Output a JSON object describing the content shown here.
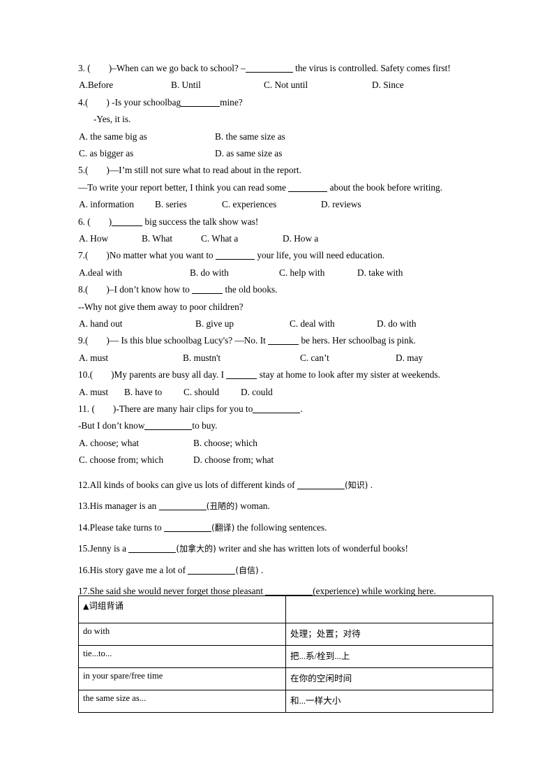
{
  "document": {
    "type": "english-grammar-worksheet",
    "questions": [
      {
        "id": "q3",
        "number": "3. (",
        "close": ")",
        "stem_before": "–When can we go back to school? –",
        "stem_after": " the virus is controlled. Safety comes first!",
        "options": [
          "A.Before",
          "B. Until",
          "C. Not until",
          "D. Since"
        ]
      },
      {
        "id": "q4",
        "number": "4.(",
        "close": ")",
        "stem_before": " -Is your schoolbag",
        "stem_after": "mine?",
        "second_line": "-Yes, it is.",
        "options": [
          "A. the same big as",
          "B. the same size as",
          "C. as bigger as",
          "D. as same size as"
        ]
      },
      {
        "id": "q5",
        "number": "5.(",
        "close": ")",
        "stem_before": "—I’m still not sure what to read about in the report.",
        "second_line_before": "—To write your report better, I think you can read some ",
        "second_line_after": " about the book before writing.",
        "options": [
          "A. information",
          "B. series",
          "C. experiences",
          "D. reviews"
        ]
      },
      {
        "id": "q6",
        "number": "6. (",
        "close": ")",
        "stem_after": " big success the talk show was!",
        "options": [
          "A. How",
          "B. What",
          "C. What a",
          "D. How a"
        ]
      },
      {
        "id": "q7",
        "number": "7.(",
        "close": ")",
        "stem_before": "No matter what you want to ",
        "stem_after": " your life, you will need education.",
        "options": [
          "A.deal with",
          "B. do with",
          "C. help with",
          "D. take with"
        ]
      },
      {
        "id": "q8",
        "number": "8.(",
        "close": ")",
        "stem_before": "–I don’t know how to ",
        "stem_after": " the old books.",
        "second_line": "--Why not give them away to poor children?",
        "options": [
          "A. hand out",
          "B. give up",
          "C. deal with",
          "D. do with"
        ]
      },
      {
        "id": "q9",
        "number": "9.(",
        "close": ")",
        "stem_before": "— Is this blue schoolbag Lucy's? —No. It ",
        "stem_after": " be hers. Her schoolbag is pink.",
        "options": [
          "A. must",
          "B. mustn't",
          "C. can’t",
          "D. may"
        ]
      },
      {
        "id": "q10",
        "number": "10.(",
        "close": ")",
        "stem_before": "My parents are busy all day. I ",
        "stem_after": " stay at home to look after my sister at weekends.",
        "options": [
          "A. must",
          "B. have to",
          "C. should",
          "D. could"
        ]
      },
      {
        "id": "q11",
        "number": "11. (",
        "close": ")",
        "stem_before": "-There are many hair clips for you to",
        "stem_after": ".",
        "second_line_before": "-But I don’t know",
        "second_line_after": "to buy.",
        "options": [
          "A. choose; what",
          "B. choose; which",
          "C. choose from; which",
          "D. choose from; what"
        ]
      }
    ],
    "fill_blanks": [
      {
        "id": "q12",
        "before": "12.All kinds of books can give us lots of different kinds of ",
        "hint": "(知识)",
        "after": " ."
      },
      {
        "id": "q13",
        "before": "13.His manager is an ",
        "hint": "(丑陋的)",
        "after": " woman."
      },
      {
        "id": "q14",
        "before": "14.Please take turns to ",
        "hint": "(翻译)",
        "after": " the following sentences."
      },
      {
        "id": "q15",
        "before": "15.Jenny is a ",
        "hint": "(加拿大的)",
        "after": " writer and she has written lots of wonderful books!"
      },
      {
        "id": "q16",
        "before": "16.His story gave me a lot of ",
        "hint": "(自信)",
        "after": " ."
      },
      {
        "id": "q17",
        "before": "17.She said she would never forget those pleasant ",
        "hint": "(experience)",
        "after": " while working here."
      }
    ],
    "phrase_table": {
      "title_marker": "▲",
      "title": "词组背诵",
      "header_right": "",
      "rows": [
        {
          "phrase": "do with",
          "meaning": "处理；处置；对待"
        },
        {
          "phrase": "tie...to...",
          "meaning": "把...系/栓到...上"
        },
        {
          "phrase": "in your spare/free time",
          "meaning": "在你的空闲时间"
        },
        {
          "phrase": "the same size as...",
          "meaning": "和...一样大小"
        }
      ]
    }
  }
}
